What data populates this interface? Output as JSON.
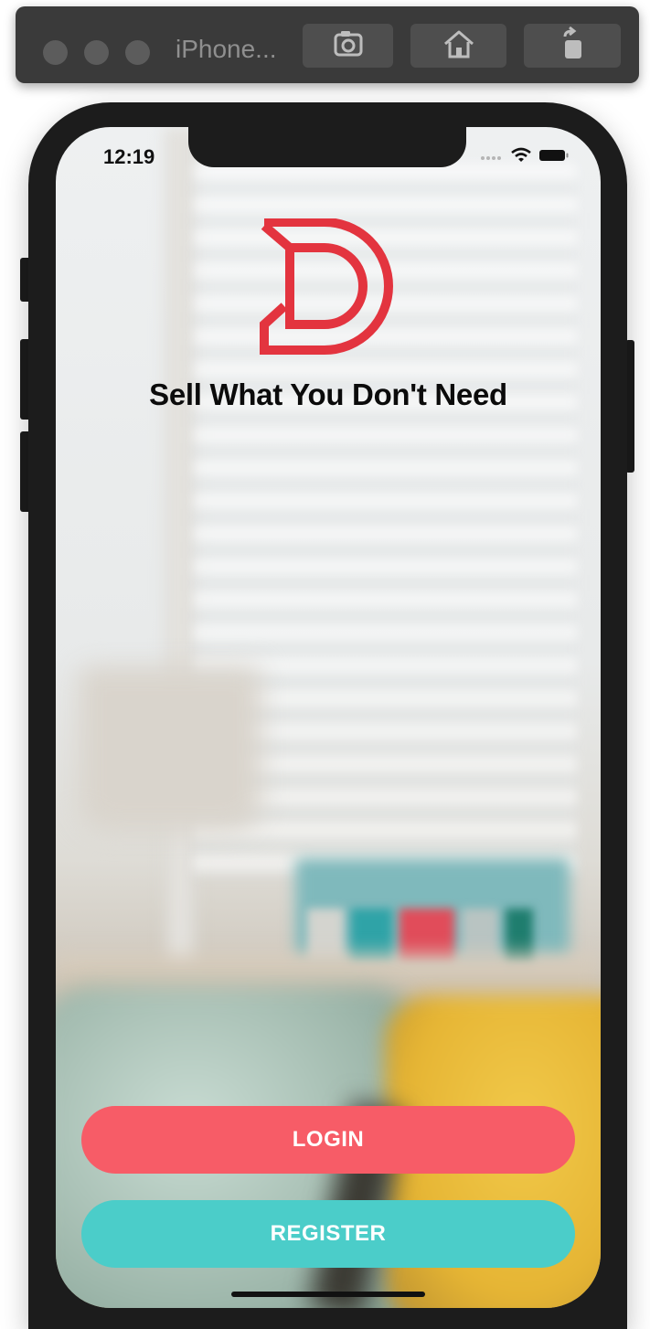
{
  "simulator": {
    "title": "iPhone...",
    "toolbar_icons": [
      "screenshot-icon",
      "home-icon",
      "rotate-icon"
    ]
  },
  "status_bar": {
    "time": "12:19",
    "icons": [
      "signal-dots-icon",
      "wifi-icon",
      "battery-icon"
    ]
  },
  "app": {
    "logo": "brand-logo",
    "tagline": "Sell What You Don't Need",
    "login_label": "LOGIN",
    "register_label": "REGISTER"
  },
  "colors": {
    "brand_red": "#e3343f",
    "login_button": "#f75c67",
    "register_button": "#4bcdc9"
  }
}
